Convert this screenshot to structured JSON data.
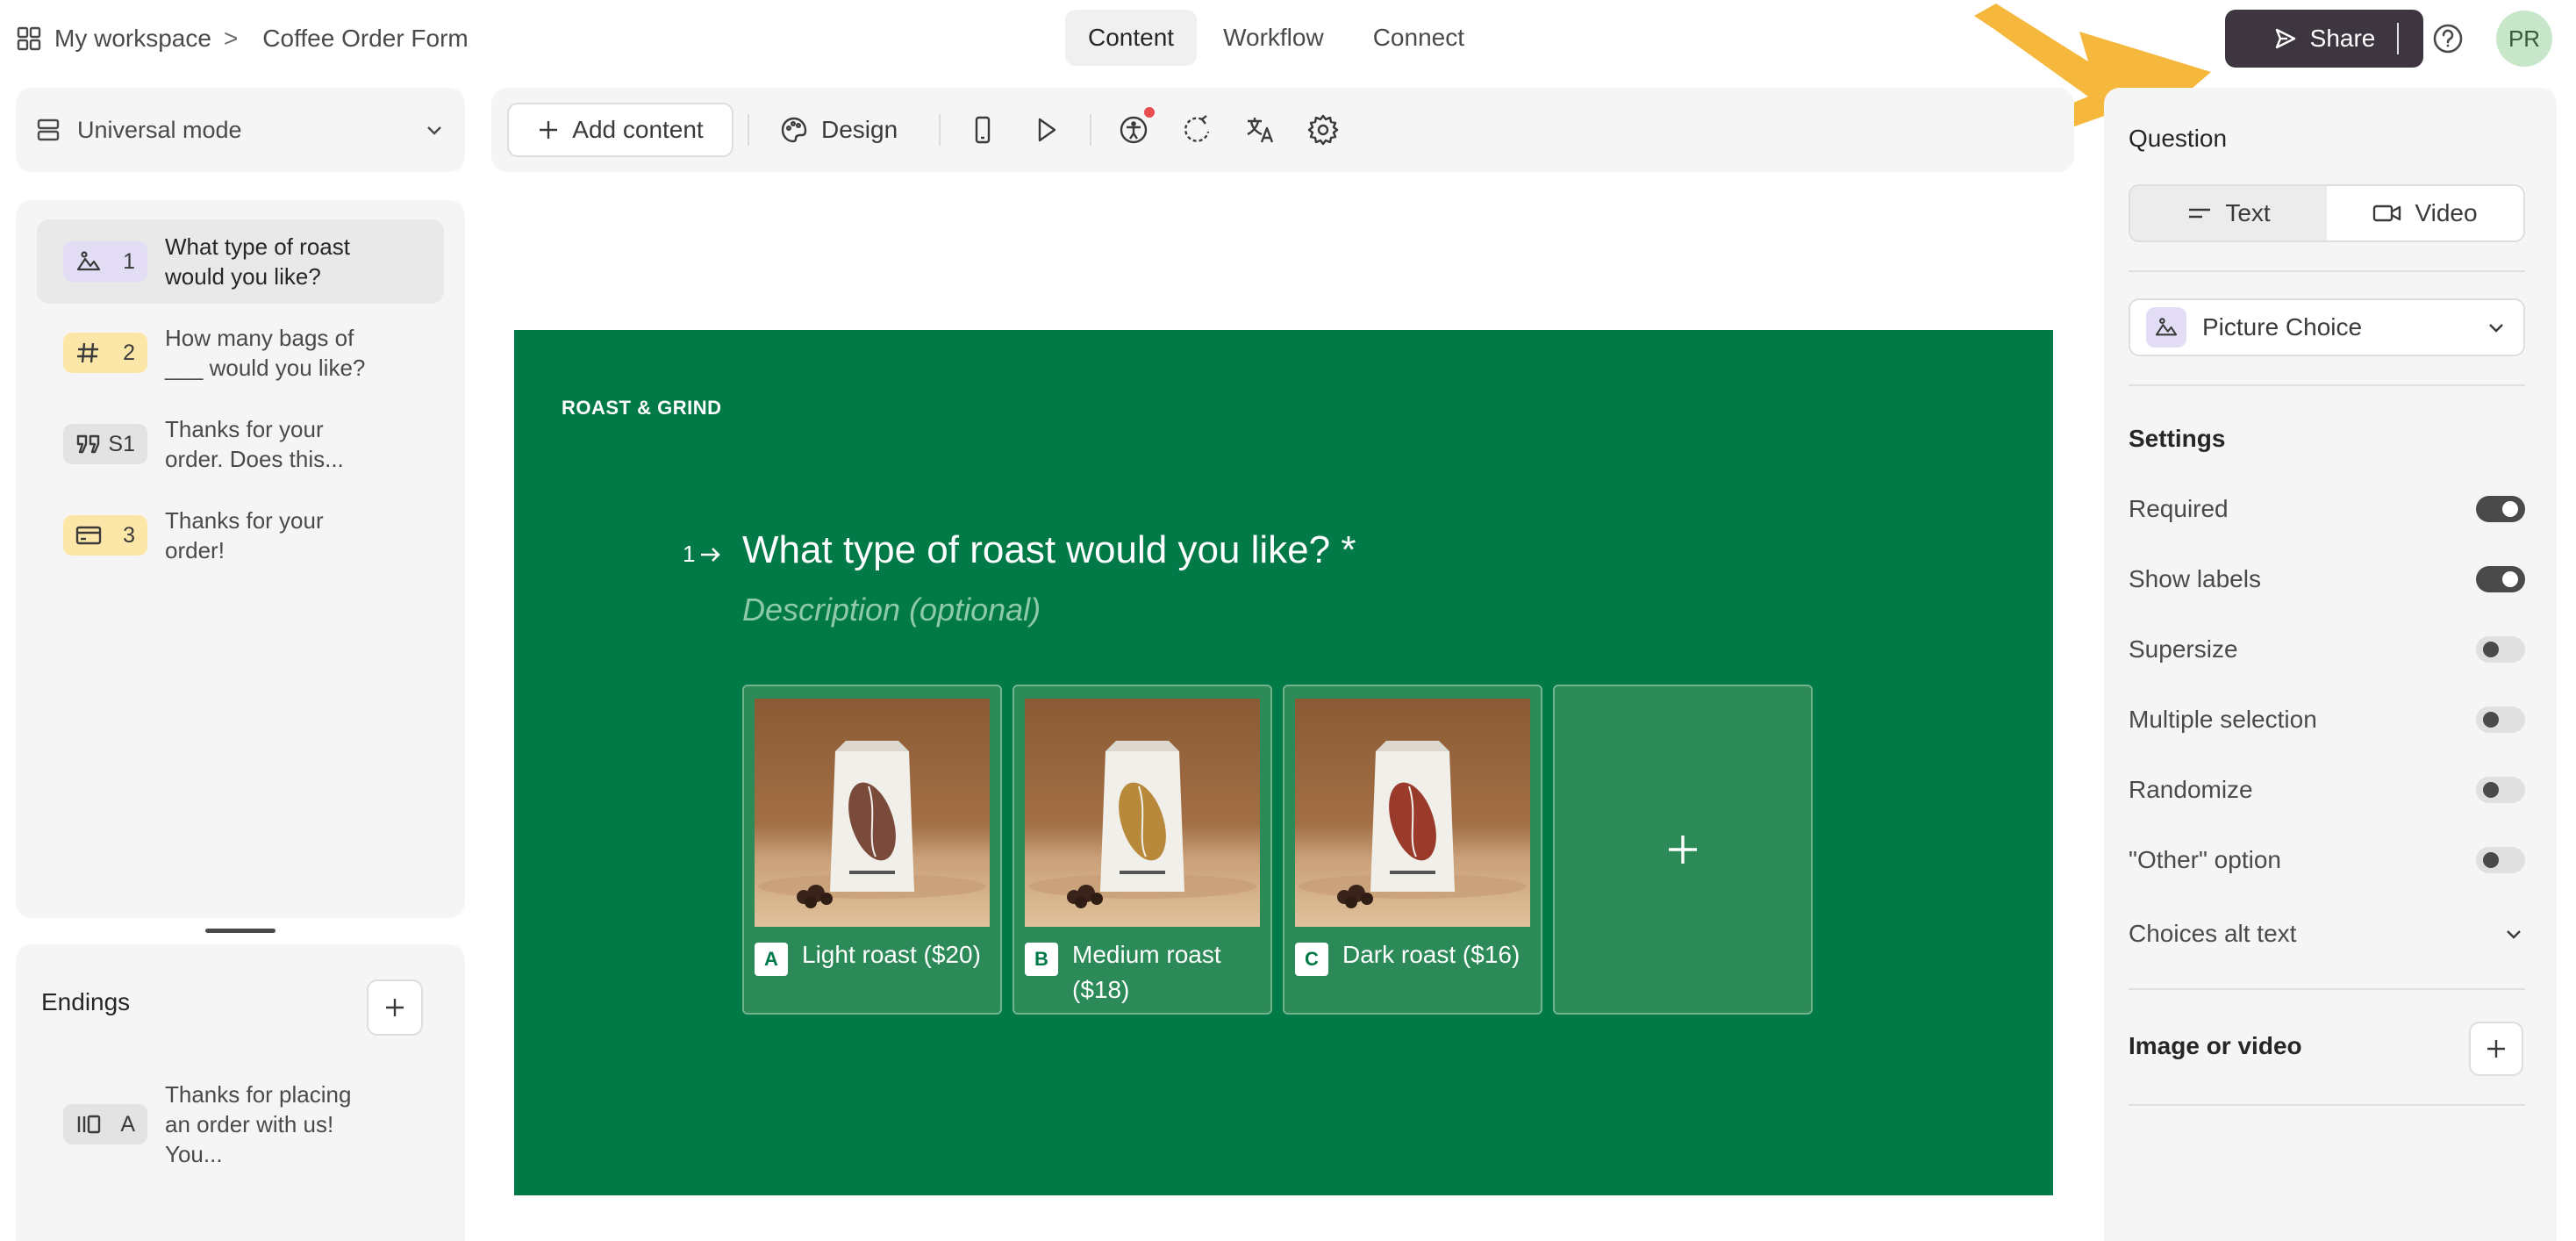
{
  "breadcrumb": {
    "workspace": "My workspace",
    "separator": ">",
    "form_name": "Coffee Order Form"
  },
  "nav": {
    "tabs": [
      {
        "label": "Content"
      },
      {
        "label": "Workflow"
      },
      {
        "label": "Connect"
      }
    ],
    "active": "Content"
  },
  "header": {
    "share_label": "Share",
    "avatar_initials": "PR"
  },
  "mode": {
    "label": "Universal mode"
  },
  "questions": [
    {
      "icon": "picture-choice-icon",
      "num": "1",
      "text": "What type of roast would you like?",
      "color": "#e3dcf5"
    },
    {
      "icon": "number-icon",
      "num": "2",
      "text": "How many bags of ___ would you like?",
      "color": "#fde7a8"
    },
    {
      "icon": "quote-icon",
      "num": "S1",
      "text": "Thanks for your order. Does this...",
      "color": "#e3e3e3"
    },
    {
      "icon": "payment-icon",
      "num": "3",
      "text": "Thanks for your order!",
      "color": "#fde7a8"
    }
  ],
  "endings": {
    "title": "Endings",
    "items": [
      {
        "icon": "ending-icon",
        "num": "A",
        "text": "Thanks for placing an order with us! You..."
      }
    ]
  },
  "toolbar": {
    "add_content": "Add content",
    "design": "Design"
  },
  "canvas": {
    "brand": "ROAST & GRIND",
    "question_number": "1",
    "question_title": "What type of roast would you like? *",
    "description_placeholder": "Description (optional)",
    "background": "#027a48",
    "choices": [
      {
        "key": "A",
        "label": "Light roast ($20)",
        "bean_color": "#7a4a3a"
      },
      {
        "key": "B",
        "label": "Medium roast ($18)",
        "bean_color": "#b8893a"
      },
      {
        "key": "C",
        "label": "Dark roast ($16)",
        "bean_color": "#9a3a2a"
      }
    ]
  },
  "right_panel": {
    "question_label": "Question",
    "segments": [
      {
        "label": "Text"
      },
      {
        "label": "Video"
      }
    ],
    "type": "Picture Choice",
    "settings_title": "Settings",
    "settings": [
      {
        "label": "Required",
        "on": true
      },
      {
        "label": "Show labels",
        "on": true
      },
      {
        "label": "Supersize",
        "on": false
      },
      {
        "label": "Multiple selection",
        "on": false
      },
      {
        "label": "Randomize",
        "on": false
      },
      {
        "label": "\"Other\" option",
        "on": false
      }
    ],
    "alt_text_label": "Choices alt text",
    "media_label": "Image or video"
  },
  "annotation": {
    "arrow_color": "#f5b83d"
  }
}
